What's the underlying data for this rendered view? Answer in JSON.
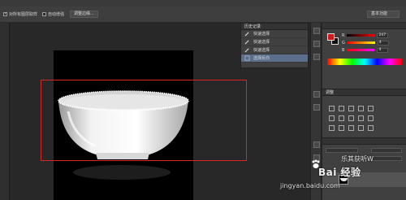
{
  "options_bar": {
    "sample_all_layers_label": "对所有图层取样",
    "auto_enhance_label": "自动增强",
    "refine_edge_label": "调整边缘...",
    "workspace_label": "基本功能"
  },
  "history_panel": {
    "tab_label": "历史记录",
    "items": [
      {
        "label": "快速选择",
        "active": false
      },
      {
        "label": "快速选择",
        "active": false
      },
      {
        "label": "快速选择",
        "active": false
      },
      {
        "label": "选择反向",
        "active": true
      }
    ]
  },
  "color_panel": {
    "foreground": "#d01818",
    "background": "#111111",
    "channels": [
      {
        "name": "R",
        "value": "247"
      },
      {
        "name": "G",
        "value": "4"
      },
      {
        "name": "B",
        "value": "4"
      }
    ]
  },
  "adjustments_panel": {
    "tab_label": "调整"
  },
  "watermark": {
    "brand": "Bai 经验",
    "account": "乐其获听W",
    "url": "jingyan.baidu.com"
  }
}
